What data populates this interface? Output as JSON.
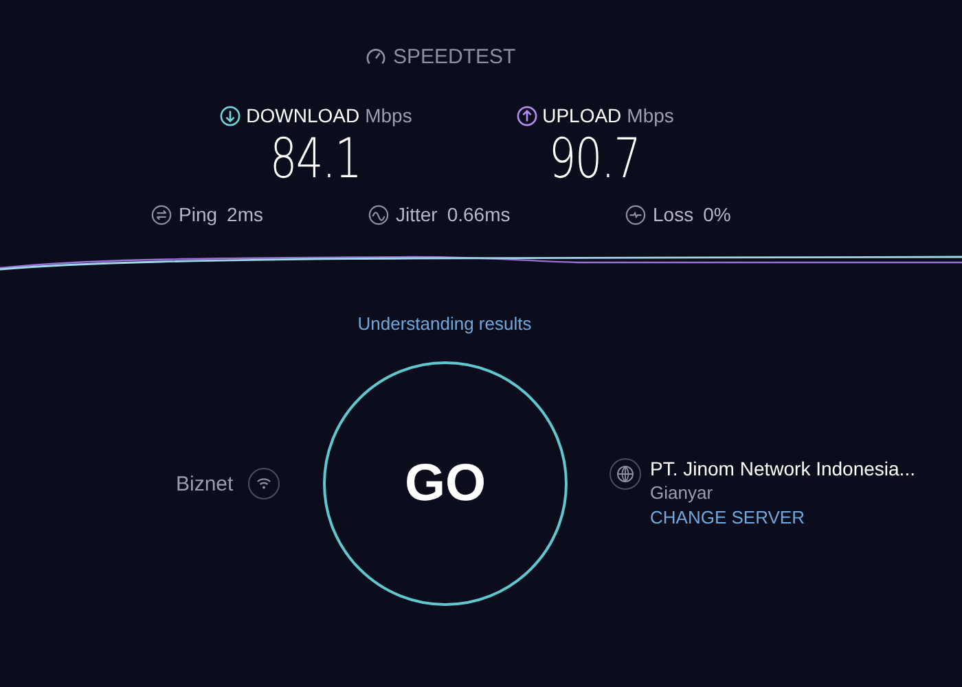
{
  "brand": {
    "name": "SPEEDTEST"
  },
  "results": [
    {
      "kind": "download",
      "label": "DOWNLOAD",
      "unit": "Mbps",
      "value": "84.1"
    },
    {
      "kind": "upload",
      "label": "UPLOAD",
      "unit": "Mbps",
      "value": "90.7"
    }
  ],
  "metrics": [
    {
      "kind": "ping",
      "label": "Ping",
      "value": "2ms"
    },
    {
      "kind": "jitter",
      "label": "Jitter",
      "value": "0.66ms"
    },
    {
      "kind": "loss",
      "label": "Loss",
      "value": "0%"
    }
  ],
  "link": "Understanding results",
  "go_button": "GO",
  "provider": {
    "name": "Biznet"
  },
  "server": {
    "name": "PT. Jinom Network Indonesia...",
    "location": "Gianyar",
    "action": "CHANGE SERVER"
  }
}
